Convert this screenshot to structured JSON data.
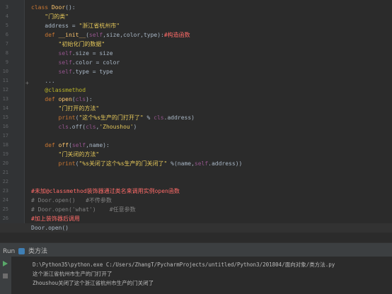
{
  "lines": [
    {
      "n": "3",
      "parts": [
        [
          "kw",
          "class "
        ],
        [
          "cls",
          "Door"
        ],
        [
          "",
          "():"
        ]
      ]
    },
    {
      "n": "4",
      "parts": [
        [
          "str",
          "    \"门的类\""
        ]
      ]
    },
    {
      "n": "5",
      "parts": [
        [
          "",
          "    address = "
        ],
        [
          "str",
          "\"浙江省杭州市\""
        ]
      ]
    },
    {
      "n": "6",
      "parts": [
        [
          "kw",
          "    def "
        ],
        [
          "fn",
          "__init__"
        ],
        [
          "",
          "("
        ],
        [
          "self",
          "self"
        ],
        [
          "",
          ",size,color,type):"
        ],
        [
          "red",
          "#构造函数"
        ]
      ]
    },
    {
      "n": "7",
      "parts": [
        [
          "str",
          "        \"初始化门的数据\""
        ]
      ]
    },
    {
      "n": "8",
      "parts": [
        [
          "self",
          "        self"
        ],
        [
          "",
          ".size = size"
        ]
      ]
    },
    {
      "n": "9",
      "parts": [
        [
          "self",
          "        self"
        ],
        [
          "",
          ".color = color"
        ]
      ]
    },
    {
      "n": "10",
      "parts": [
        [
          "self",
          "        self"
        ],
        [
          "",
          ".type = type"
        ]
      ]
    },
    {
      "n": "11",
      "parts": [
        [
          "",
          "    ..."
        ]
      ]
    },
    {
      "n": "12",
      "parts": [
        [
          "dec",
          "    @classmethod"
        ]
      ]
    },
    {
      "n": "13",
      "parts": [
        [
          "kw",
          "    def "
        ],
        [
          "fn",
          "open"
        ],
        [
          "",
          "("
        ],
        [
          "self",
          "cls"
        ],
        [
          "",
          "):"
        ]
      ]
    },
    {
      "n": "14",
      "parts": [
        [
          "str",
          "        \"门打开的方法\""
        ]
      ]
    },
    {
      "n": "15",
      "parts": [
        [
          "kw",
          "        print"
        ],
        [
          "",
          "("
        ],
        [
          "str",
          "\"这个%s生产的门打开了\""
        ],
        [
          "",
          " % "
        ],
        [
          "self",
          "cls"
        ],
        [
          "",
          ".address)"
        ]
      ]
    },
    {
      "n": "16",
      "parts": [
        [
          "self",
          "        cls"
        ],
        [
          "",
          ".off("
        ],
        [
          "self",
          "cls"
        ],
        [
          "",
          ","
        ],
        [
          "str",
          "'Zhoushou'"
        ],
        [
          "",
          ")"
        ]
      ]
    },
    {
      "n": "17",
      "parts": [
        [
          "",
          ""
        ]
      ]
    },
    {
      "n": "18",
      "parts": [
        [
          "kw",
          "    def "
        ],
        [
          "fn",
          "off"
        ],
        [
          "",
          "("
        ],
        [
          "self",
          "self"
        ],
        [
          "",
          ",name):"
        ]
      ]
    },
    {
      "n": "19",
      "parts": [
        [
          "str",
          "        \"门关闭的方法\""
        ]
      ]
    },
    {
      "n": "20",
      "parts": [
        [
          "kw",
          "        print"
        ],
        [
          "",
          "("
        ],
        [
          "str",
          "\"%s关闭了这个%s生产的门关闭了\""
        ],
        [
          "",
          " %(name,"
        ],
        [
          "self",
          "self"
        ],
        [
          "",
          ".address))"
        ]
      ]
    },
    {
      "n": "21",
      "parts": [
        [
          "",
          ""
        ]
      ]
    },
    {
      "n": "22",
      "parts": [
        [
          "",
          ""
        ]
      ]
    },
    {
      "n": "23",
      "parts": [
        [
          "red",
          "#未加@classmethod装饰器通过类名来调用实例open函数"
        ]
      ]
    },
    {
      "n": "24",
      "parts": [
        [
          "cmt",
          "# Door.open()   #不传参数"
        ]
      ]
    },
    {
      "n": "25",
      "parts": [
        [
          "cmt",
          "# Door.open('what')    #任意参数"
        ]
      ]
    },
    {
      "n": "26",
      "parts": [
        [
          "red",
          "#加上装饰器后调用"
        ]
      ]
    },
    {
      "n": "27",
      "parts": [
        [
          "",
          "Door.open()"
        ]
      ]
    }
  ],
  "run": {
    "tab_label": "Run",
    "config_name": "类方法",
    "output": [
      "D:\\Python35\\python.exe C:/Users/ZhangT/PycharmProjects/untitled/Python3/201804/面向对象/类方法.py",
      "这个浙江省杭州市生产的门打开了",
      "Zhoushou关闭了这个浙江省杭州市生产的门关闭了"
    ]
  },
  "colors": {
    "editor_bg": "#2b2b2b",
    "keyword": "#cc7832",
    "string": "#e6c85a",
    "self": "#94558d"
  }
}
